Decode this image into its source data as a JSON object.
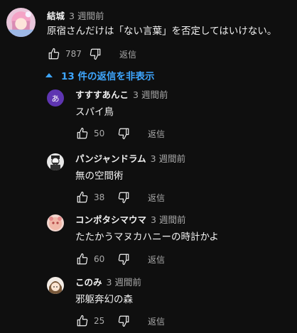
{
  "comment": {
    "author": "結城",
    "time": "3 週間前",
    "text": "原宿さんだけは「ない言葉」を否定してはいけない。",
    "likes": "787",
    "reply_label": "返信"
  },
  "replies_toggle": {
    "label": "13 件の返信を非表示"
  },
  "replies": [
    {
      "author": "すすすあんこ",
      "time": "3 週間前",
      "text": "スパイ鳥",
      "likes": "50",
      "reply_label": "返信",
      "avatar_letter": "あ"
    },
    {
      "author": "パンジャンドラム",
      "time": "3 週間前",
      "text": "無の空間術",
      "likes": "38",
      "reply_label": "返信"
    },
    {
      "author": "コンポタシマウマ",
      "time": "3 週間前",
      "text": "たたかうマヌカハニーの時計かよ",
      "likes": "60",
      "reply_label": "返信"
    },
    {
      "author": "このみ",
      "time": "3 週間前",
      "text": "邪躯奔幻の森",
      "likes": "25",
      "reply_label": "返信"
    }
  ],
  "colors": {
    "background": "#0f0f0f",
    "link_blue": "#3ea6ff",
    "secondary_text": "#aaaaaa",
    "avatar_purple": "#5e35b1"
  }
}
